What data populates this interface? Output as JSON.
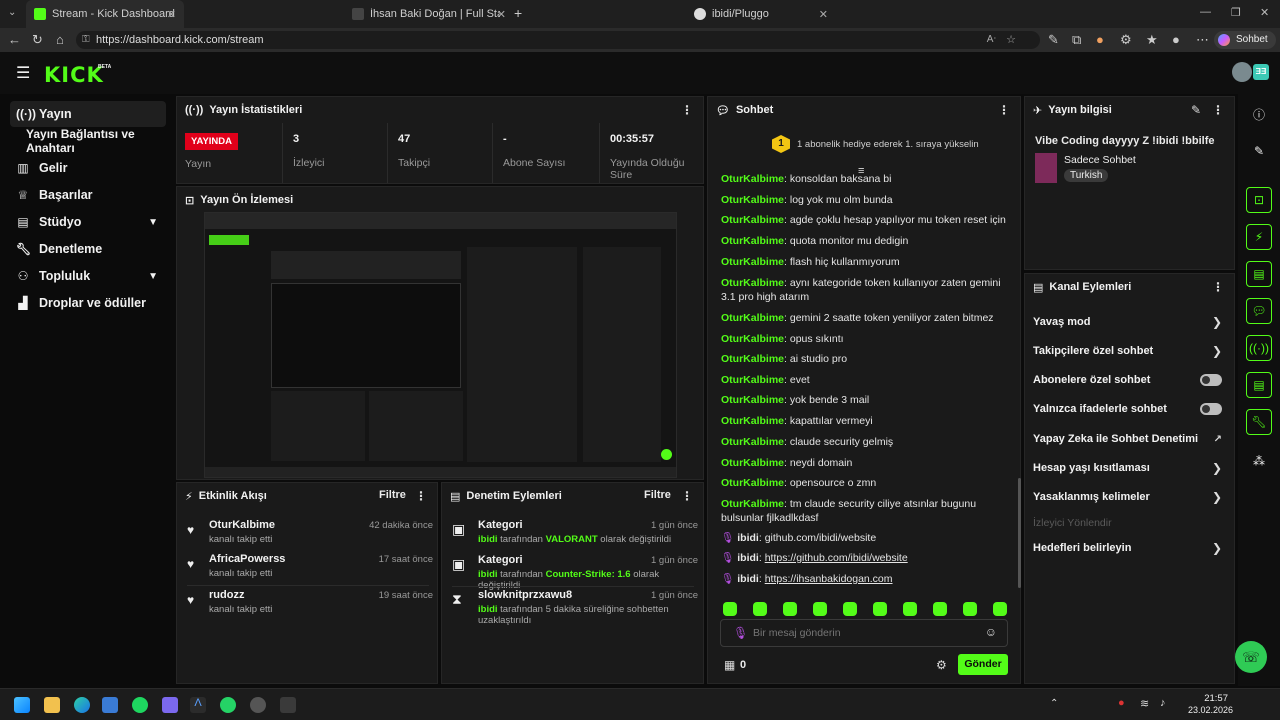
{
  "browser": {
    "tabs": [
      {
        "title": "Stream - Kick Dashboard"
      },
      {
        "title": "İhsan Baki Doğan | Full Stack Deve"
      },
      {
        "title": "ibidi/Pluggo"
      }
    ],
    "url": "https://dashboard.kick.com/stream",
    "copilot_label": "Sohbet et"
  },
  "app": {
    "logo": "KICK",
    "logo_sup": "BETA",
    "avatar_text": "ƎƎ"
  },
  "sidebar": {
    "items": [
      {
        "label": "Yayın",
        "icon": "broadcast-icon"
      },
      {
        "label": "Yayın Bağlantısı ve Anahtarı"
      },
      {
        "label": "Gelir",
        "icon": "chart-icon"
      },
      {
        "label": "Başarılar",
        "icon": "trophy-icon"
      },
      {
        "label": "Stüdyo",
        "icon": "studio-icon"
      },
      {
        "label": "Denetleme",
        "icon": "wrench-icon"
      },
      {
        "label": "Topluluk",
        "icon": "community-icon"
      },
      {
        "label": "Droplar ve ödüller",
        "icon": "gift-icon"
      }
    ]
  },
  "stats": {
    "title": "Yayın İstatistikleri",
    "items": [
      {
        "value": "YAYINDA",
        "label": "Yayın"
      },
      {
        "value": "3",
        "label": "İzleyici"
      },
      {
        "value": "47",
        "label": "Takipçi"
      },
      {
        "value": "-",
        "label": "Abone Sayısı"
      },
      {
        "value": "00:35:57",
        "label": "Yayında Olduğu Süre"
      }
    ]
  },
  "preview": {
    "title": "Yayın Ön İzlemesi"
  },
  "activity": {
    "title": "Etkinlik Akışı",
    "filter": "Filtre",
    "items": [
      {
        "name": "OturKalbime",
        "sub": "kanalı takip etti",
        "time": "42 dakika önce"
      },
      {
        "name": "AfricaPowerss",
        "sub": "kanalı takip etti",
        "time": "17 saat önce"
      },
      {
        "name": "rudozz",
        "sub": "kanalı takip etti",
        "time": "19 saat önce"
      }
    ]
  },
  "moderation": {
    "title": "Denetim Eylemleri",
    "filter": "Filtre",
    "items": [
      {
        "name": "Kategori",
        "actor": "ibidi",
        "pre": " tarafından ",
        "hl": "VALORANT",
        "post": " olarak değiştirildi",
        "time": "1 gün önce"
      },
      {
        "name": "Kategori",
        "actor": "ibidi",
        "pre": " tarafından ",
        "hl": "Counter-Strike: 1.6",
        "post": " olarak değiştirildi",
        "time": "1 gün önce"
      },
      {
        "name": "slowknitprzxawu8",
        "actor": "ibidi",
        "pre": " tarafından 5 dakika süreliğine sohbetten uzaklaştırıldı",
        "hl": "",
        "post": "",
        "time": "1 gün önce"
      }
    ]
  },
  "chat": {
    "title": "Sohbet",
    "gift_banner": "1 abonelik hediye ederek 1. sıraya yükselin",
    "gift_rank": "1",
    "messages": [
      {
        "user": "OturKalbime",
        "text": "konsoldan baksana bi"
      },
      {
        "user": "OturKalbime",
        "text": "log yok mu olm bunda"
      },
      {
        "user": "OturKalbime",
        "text": "agde çoklu hesap yapılıyor mu token reset için"
      },
      {
        "user": "OturKalbime",
        "text": "quota monitor mu dedigin"
      },
      {
        "user": "OturKalbime",
        "text": "flash hiç kullanmıyorum"
      },
      {
        "user": "OturKalbime",
        "text": "aynı kategoride token kullanıyor zaten gemini 3.1 pro high atarım"
      },
      {
        "user": "OturKalbime",
        "text": "gemini 2 saatte token yeniliyor zaten bitmez"
      },
      {
        "user": "OturKalbime",
        "text": "opus sıkıntı"
      },
      {
        "user": "OturKalbime",
        "text": "ai studio pro"
      },
      {
        "user": "OturKalbime",
        "text": "evet"
      },
      {
        "user": "OturKalbime",
        "text": "yok bende 3 mail"
      },
      {
        "user": "OturKalbime",
        "text": "kapattılar vermeyi"
      },
      {
        "user": "OturKalbime",
        "text": "claude security gelmiş"
      },
      {
        "user": "OturKalbime",
        "text": "neydi domain"
      },
      {
        "user": "OturKalbime",
        "text": "opensource o zmn"
      },
      {
        "user": "OturKalbime",
        "text": "tm claude security ciliye atsınlar bugunu bulsunlar fjlkadlkdasf"
      },
      {
        "user": "ibidi",
        "text": "github.com/ibidi/website"
      },
      {
        "user": "ibidi",
        "text": "https://github.com/ibidi/website"
      },
      {
        "user": "ibidi",
        "text": "https://ihsanbakidogan.com"
      }
    ],
    "input_placeholder": "Bir mesaj gönderin",
    "points": "0",
    "send": "Gönder"
  },
  "stream_info": {
    "title": "Yayın bilgisi",
    "stream_title": "Vibe Coding dayyyy Z !ibidi !bbilfe",
    "category": "Sadece Sohbet",
    "language": "Turkish"
  },
  "channel_actions": {
    "title": "Kanal Eylemleri",
    "items": [
      {
        "label": "Yavaş mod",
        "kind": "chevron"
      },
      {
        "label": "Takipçilere özel sohbet",
        "kind": "chevron"
      },
      {
        "label": "Abonelere özel sohbet",
        "kind": "toggle"
      },
      {
        "label": "Yalnızca ifadelerle sohbet",
        "kind": "toggle"
      },
      {
        "label": "Yapay Zeka ile Sohbet Denetimi",
        "kind": "external"
      },
      {
        "label": "Hesap yaşı kısıtlaması",
        "kind": "chevron"
      },
      {
        "label": "Yasaklanmış kelimeler",
        "kind": "chevron"
      },
      {
        "label": "İzleyici Yönlendir",
        "kind": "disabled"
      },
      {
        "label": "Hedefleri belirleyin",
        "kind": "chevron"
      }
    ]
  },
  "taskbar": {
    "time": "21:57",
    "date": "23.02.2026"
  },
  "colors": {
    "accent": "#53fc18",
    "live": "#e1001a",
    "panel": "#1a1a1a"
  }
}
